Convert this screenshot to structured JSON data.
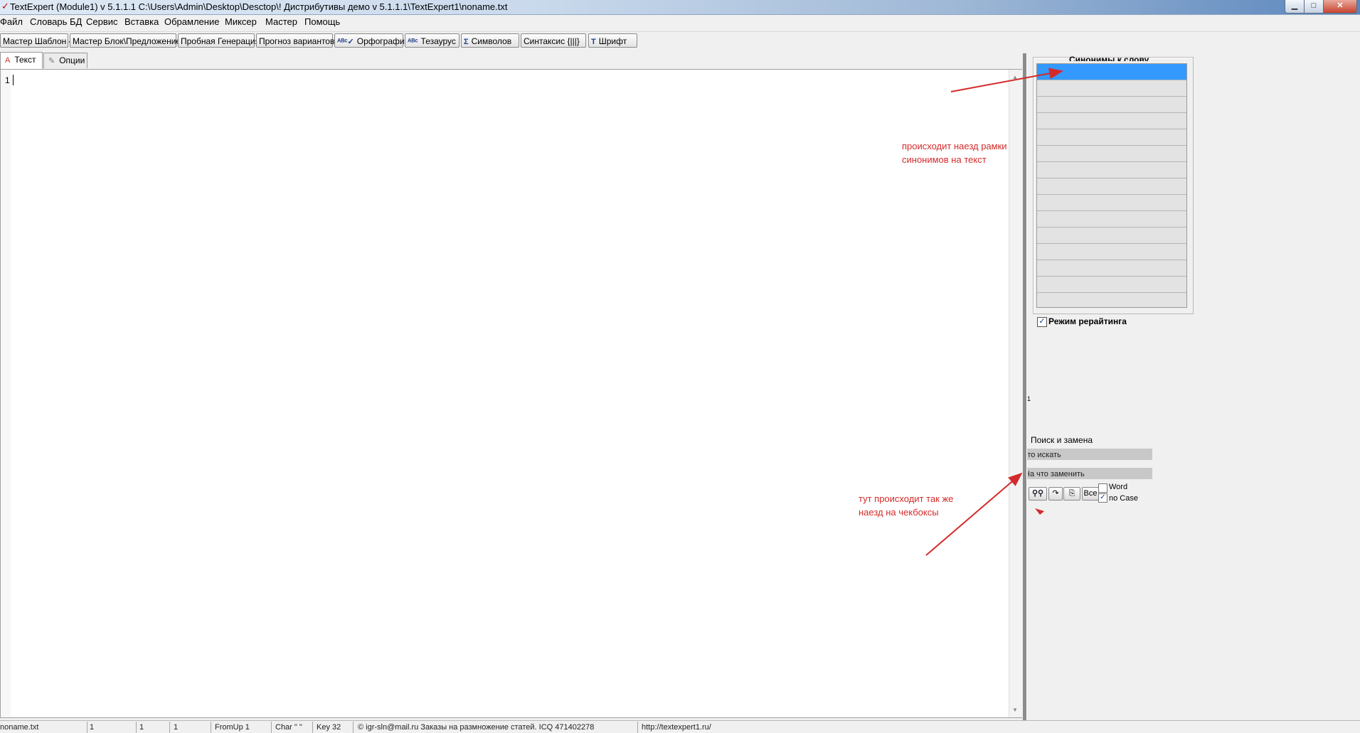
{
  "window": {
    "title": "TextExpert (Module1) v 5.1.1.1   C:\\Users\\Admin\\Desktop\\Desctop\\! Дистрибутивы демо v 5.1.1.1\\TextExpert1\\noname.txt",
    "controls": {
      "minimize": "▁",
      "maximize": "□",
      "close": "✕"
    }
  },
  "menu": [
    "Файл",
    "Словарь БД",
    "Сервис",
    "Вставка",
    "Обрамление",
    "Миксер",
    "Мастер",
    "Помощь"
  ],
  "toolbar": [
    {
      "label": "Мастер Шаблон {|}",
      "icon": ""
    },
    {
      "label": "Мастер Блок\\Предложение",
      "icon": ""
    },
    {
      "label": "Пробная Генерация",
      "icon": ""
    },
    {
      "label": "Прогноз вариантов",
      "icon": ""
    },
    {
      "label": "Орфография",
      "icon": "ᴬᴮᶜ✓"
    },
    {
      "label": "Тезаурус",
      "icon": "ᴬᴮᶜ"
    },
    {
      "label": "Символов",
      "icon": "Σ"
    },
    {
      "label": "Синтаксис {|||}",
      "icon": ""
    },
    {
      "label": "Шрифт",
      "icon": "T"
    }
  ],
  "tabs": {
    "text": "Текст",
    "options": "Опции"
  },
  "editor": {
    "line_number": "1"
  },
  "synonyms": {
    "title": "Синонимы к слову"
  },
  "rewrite": {
    "label": "Режим рерайтинга",
    "checked": true
  },
  "misc_digit": "1",
  "search": {
    "title": "Поиск и замена",
    "find_placeholder": "Что искать",
    "replace_placeholder": "На что заменить",
    "all_label": "Все",
    "word_label": "Word",
    "case_label": "no Case",
    "word_checked": false,
    "case_checked": true
  },
  "annotations": {
    "top_line1": "происходит наезд рамки",
    "top_line2": "синонимов на текст",
    "bottom_line1": "тут происходит так же",
    "bottom_line2": "наезд на чекбоксы",
    "color": "#d42a2a"
  },
  "status": {
    "file": "noname.txt",
    "line": "1",
    "col": "1",
    "pos": "1",
    "fromup": "FromUp 1",
    "char": "Char \" \"",
    "key": "Key 32",
    "contact": "© igr-sln@mail.ru Заказы на размножение статей. ICQ 471402278",
    "url": "http://textexpert1.ru/"
  }
}
